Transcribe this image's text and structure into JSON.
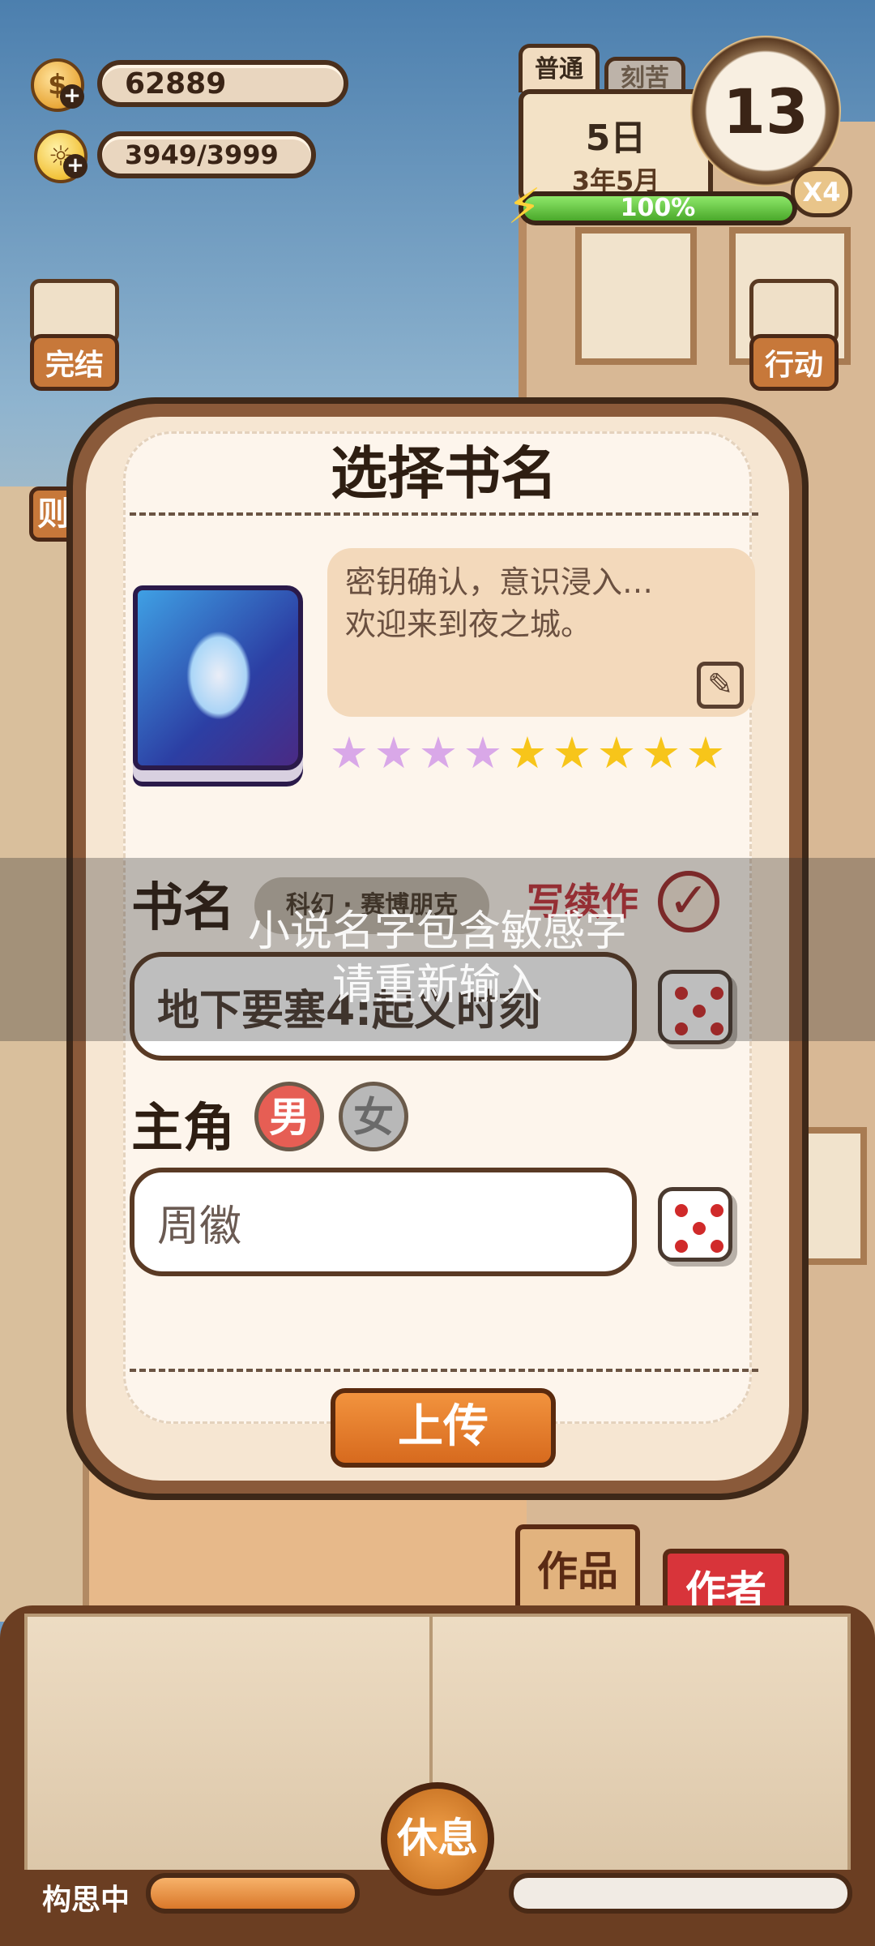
{
  "hud": {
    "coins": "62889",
    "ideas": "3949/3999",
    "mode_tabs": [
      "普通",
      "刻苦"
    ],
    "day": "5日",
    "date": "3年5月",
    "clock_hour": "13",
    "speed": "X4",
    "energy_percent": "100%",
    "energy_fraction": 1.0
  },
  "side": {
    "finish_label": "完结",
    "action_label": "行动",
    "hidden_label": "则"
  },
  "dialog": {
    "title": "选择书名",
    "description": "密钥确认，意识浸入…\n欢迎来到夜之城。",
    "stars_rainbow": 4,
    "stars_gold": 5,
    "book_name_label": "书名",
    "genre": "科幻 · 赛博朋克",
    "sequel_label": "写续作",
    "book_name_value": "地下要塞4:起义时刻",
    "protagonist_label": "主角",
    "gender_male": "男",
    "gender_female": "女",
    "protagonist_value": "周徽",
    "upload_label": "上传"
  },
  "toast": {
    "line1": "小说名字包含敏感字",
    "line2": "请重新输入"
  },
  "bottom": {
    "works_tab": "作品",
    "author_tab": "作者",
    "progress_label": "构思中",
    "rest_label": "休息"
  }
}
